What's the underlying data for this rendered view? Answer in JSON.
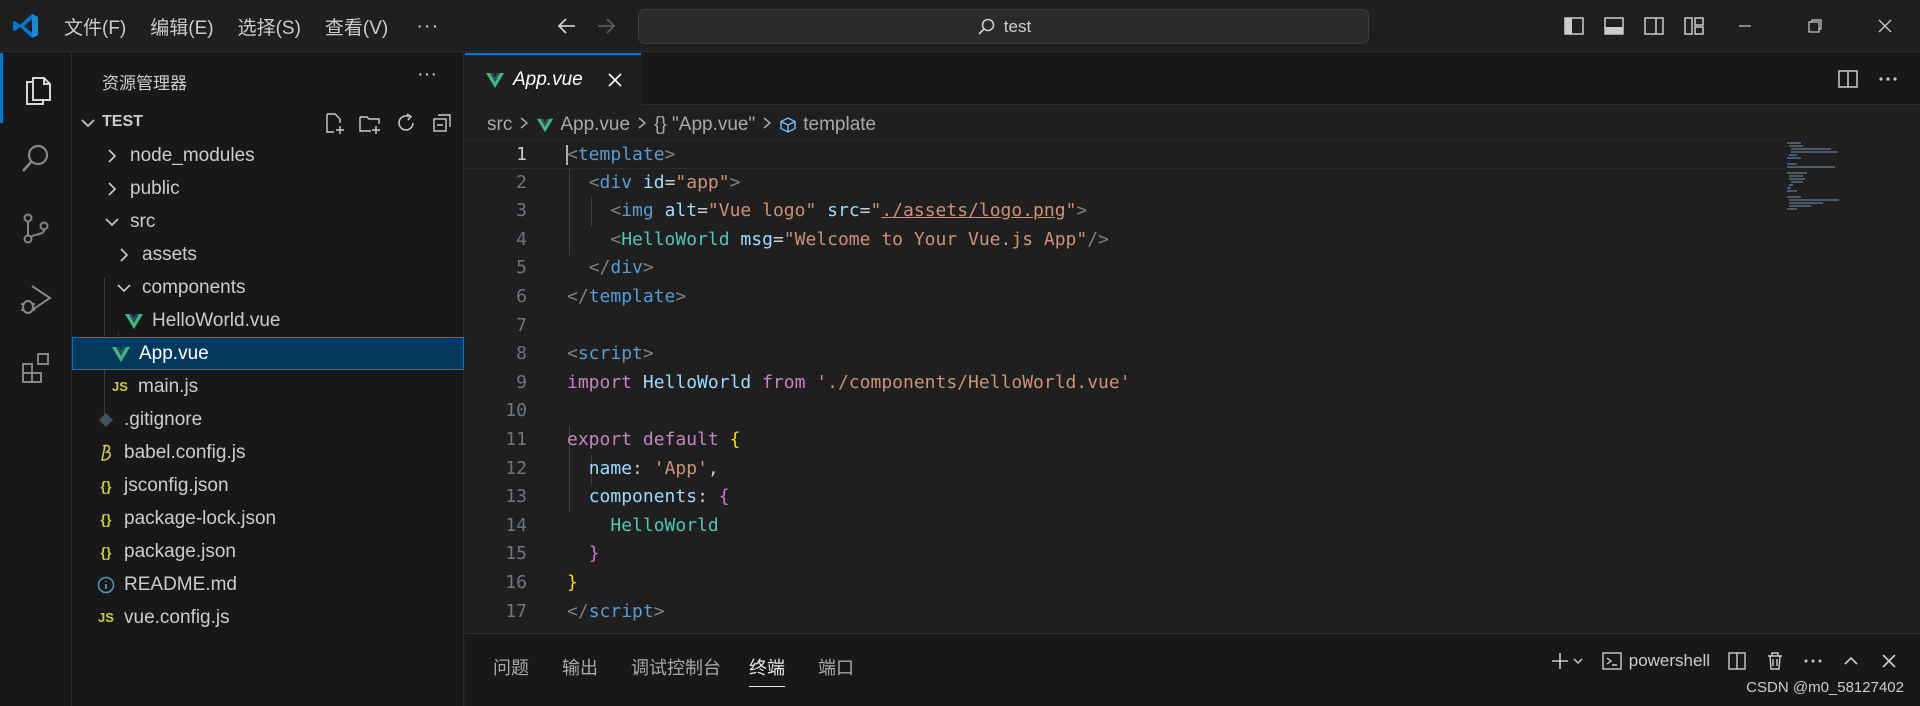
{
  "menu": {
    "file": "文件(F)",
    "edit": "编辑(E)",
    "selection": "选择(S)",
    "view": "查看(V)",
    "more": "···"
  },
  "search": {
    "text": "test"
  },
  "sidebar": {
    "title": "资源管理器",
    "more": "···",
    "section": "TEST",
    "items": [
      {
        "label": "node_modules",
        "type": "folder-closed"
      },
      {
        "label": "public",
        "type": "folder-closed"
      },
      {
        "label": "src",
        "type": "folder-open"
      },
      {
        "label": "assets",
        "type": "folder-closed"
      },
      {
        "label": "components",
        "type": "folder-open"
      },
      {
        "label": "HelloWorld.vue",
        "type": "vue"
      },
      {
        "label": "App.vue",
        "type": "vue",
        "selected": true
      },
      {
        "label": "main.js",
        "type": "js",
        "icon_text": "JS"
      },
      {
        "label": ".gitignore",
        "type": "git"
      },
      {
        "label": "babel.config.js",
        "type": "babel"
      },
      {
        "label": "jsconfig.json",
        "type": "json",
        "icon_text": "{}"
      },
      {
        "label": "package-lock.json",
        "type": "json",
        "icon_text": "{}"
      },
      {
        "label": "package.json",
        "type": "json",
        "icon_text": "{}"
      },
      {
        "label": "README.md",
        "type": "info"
      },
      {
        "label": "vue.config.js",
        "type": "js",
        "icon_text": "JS"
      }
    ]
  },
  "editor": {
    "tab_label": "App.vue",
    "breadcrumb": {
      "src": "src",
      "file": "App.vue",
      "symbol": "{} \"App.vue\"",
      "node": "template"
    },
    "lines": [
      "1",
      "2",
      "3",
      "4",
      "5",
      "6",
      "7",
      "8",
      "9",
      "10",
      "11",
      "12",
      "13",
      "14",
      "15",
      "16",
      "17"
    ]
  },
  "panel": {
    "tabs": [
      "问题",
      "输出",
      "调试控制台",
      "终端",
      "端口"
    ],
    "active_tab": "终端",
    "terminal": "powershell"
  },
  "watermark": "CSDN @m0_58127402",
  "colors": {
    "accent": "#0078d4",
    "vue_green": "#41b883",
    "js_yellow": "#cbcb41",
    "selection": "#04395e"
  }
}
